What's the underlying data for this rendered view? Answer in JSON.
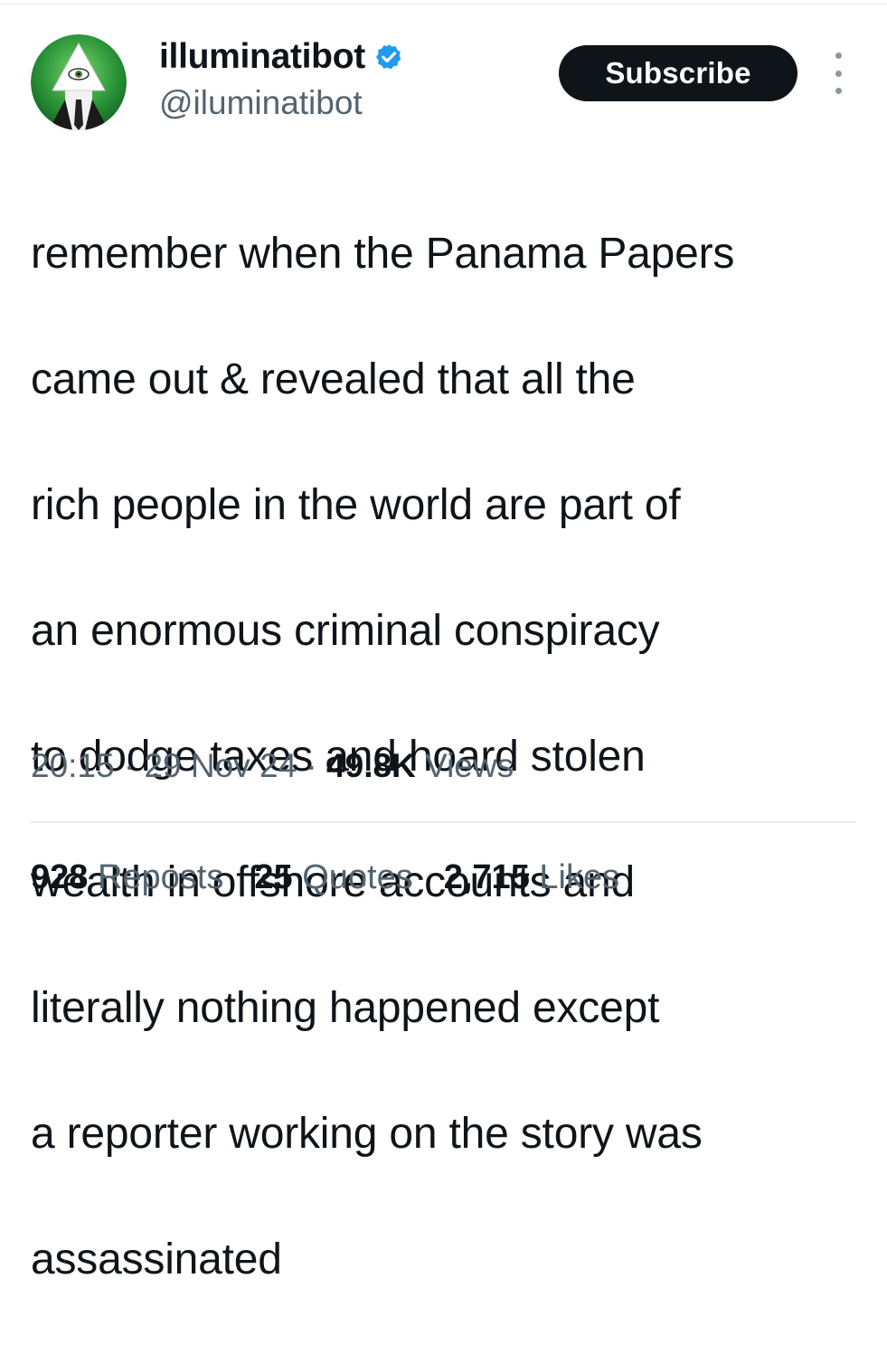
{
  "tweet": {
    "author": {
      "display_name": "illuminatibot",
      "handle": "@iluminatibot",
      "verified_icon": "verified-badge-icon",
      "verified_color": "#1d9bf0",
      "avatar_icon": "illuminati-eye-pyramid-avatar"
    },
    "subscribe_label": "Subscribe",
    "more_icon": "more-vertical-icon",
    "text_lines": [
      "remember when the Panama Papers",
      "came out & revealed that all the",
      "rich people in the world are part of",
      "an enormous criminal conspiracy",
      "to dodge taxes and hoard stolen",
      "wealth in offshore accounts and",
      "literally nothing happened except",
      "a reporter working on the story was",
      "assassinated"
    ],
    "meta": {
      "time": "20:15",
      "separator": " · ",
      "date": "29 Nov 24",
      "views_count": "49.8K",
      "views_label": " Views"
    },
    "stats": {
      "reposts_count": "928",
      "reposts_label": " Reposts",
      "quotes_count": "25",
      "quotes_label": " Quotes",
      "likes_count": "2,715",
      "likes_label": " Likes"
    }
  },
  "colors": {
    "text_primary": "#0f1419",
    "text_secondary": "#536471",
    "button_bg": "#0f1419",
    "divider": "#e6e9ec",
    "avatar_green": "#2e8b3a"
  }
}
